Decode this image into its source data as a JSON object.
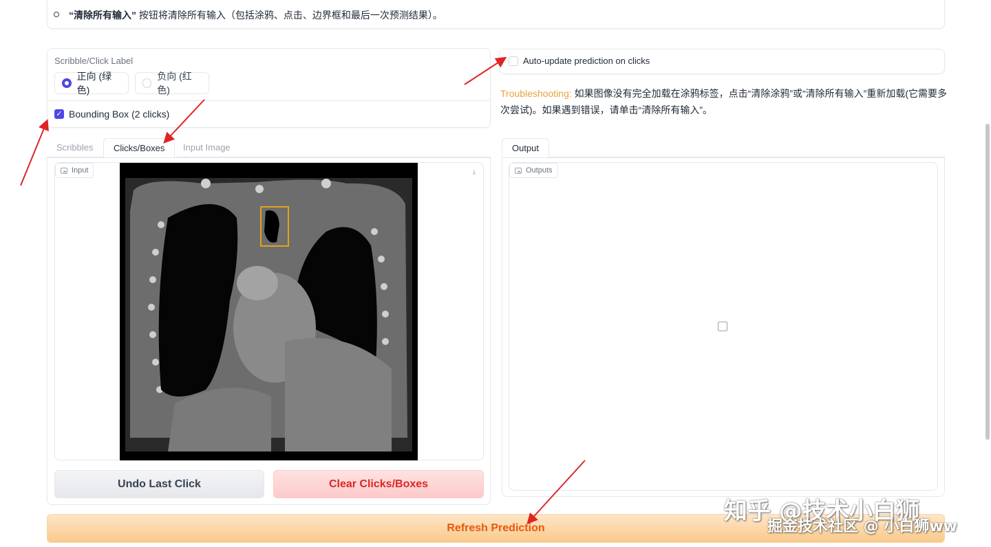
{
  "top_note": {
    "quoted": "“清除所有输入”",
    "text": " 按钮将清除所有输入（包括涂鸦、点击、边界框和最后一次预测结果）。"
  },
  "label_panel": {
    "title": "Scribble/Click Label",
    "options": [
      {
        "label": "正向 (绿色)",
        "selected": true
      },
      {
        "label": "负向 (红色)",
        "selected": false
      }
    ],
    "bounding_box_label": "Bounding Box (2 clicks)",
    "bounding_box_checked": true
  },
  "auto_update": {
    "label": "Auto-update prediction on clicks",
    "checked": false
  },
  "troubleshooting": {
    "prefix": "Troubleshooting:",
    "text": " 如果图像没有完全加载在涂鸦标签，点击“清除涂鸦”或“清除所有输入”重新加载(它需要多次尝试)。如果遇到错误，请单击“清除所有输入”。"
  },
  "input_tabs": {
    "items": [
      "Scribbles",
      "Clicks/Boxes",
      "Input Image"
    ],
    "active": "Clicks/Boxes"
  },
  "input_block": {
    "label": "Input"
  },
  "output_tabs": {
    "items": [
      "Output"
    ],
    "active": "Output"
  },
  "output_block": {
    "label": "Outputs"
  },
  "buttons": {
    "undo": "Undo Last Click",
    "clear": "Clear Clicks/Boxes",
    "refresh": "Refresh Prediction"
  },
  "watermarks": {
    "line1": "知乎 @技术小白狮",
    "line2": "掘金技术社区 @ 小白狮ww"
  },
  "colors": {
    "accent": "#4f46e5",
    "troubleshooting": "#e8a33d",
    "annotation_arrow": "#e02424",
    "box_outline": "#e3a21a",
    "clear_button_text": "#dc2626",
    "refresh_button_text": "#ea580c"
  }
}
